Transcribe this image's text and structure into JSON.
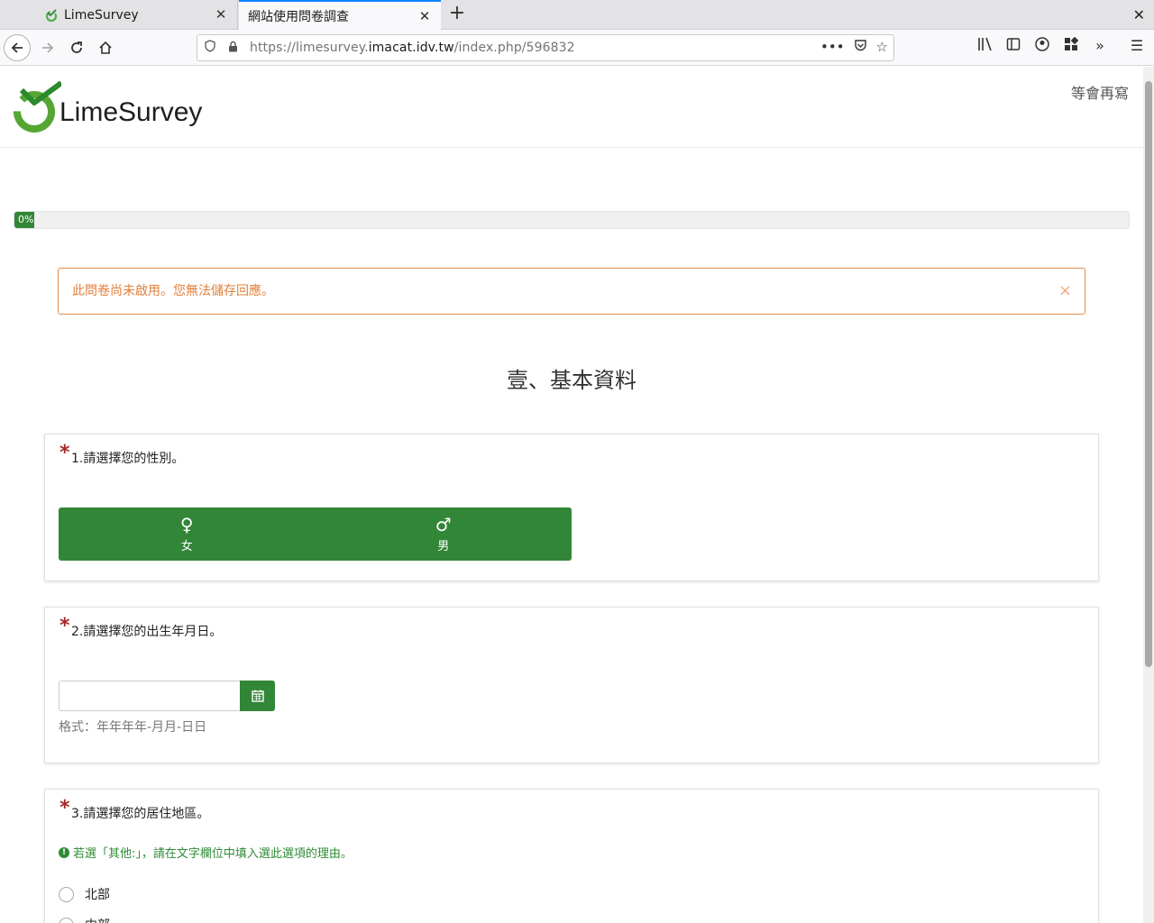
{
  "browser": {
    "tabs": [
      {
        "title": "LimeSurvey"
      },
      {
        "title": "網站使用問卷調查"
      }
    ],
    "url_prefix": "https://limesurvey.",
    "url_host": "imacat.idv.tw",
    "url_path": "/index.php/596832"
  },
  "header": {
    "logo_text": "LimeSurvey",
    "save_later": "等會再寫"
  },
  "progress": {
    "label": "0%",
    "value": 0
  },
  "alert": {
    "text": "此問卷尚未啟用。您無法儲存回應。",
    "close": "×"
  },
  "group": {
    "title": "壹、基本資料"
  },
  "questions": [
    {
      "required_mark": "*",
      "text": "1.請選擇您的性別。",
      "options": [
        {
          "symbol": "♀",
          "label": "女"
        },
        {
          "symbol": "♂",
          "label": "男"
        }
      ]
    },
    {
      "required_mark": "*",
      "text": "2.請選擇您的出生年月日。",
      "date_value": "",
      "help": "格式：年年年年-月月-日日"
    },
    {
      "required_mark": "*",
      "text": "3.請選擇您的居住地區。",
      "tip": "若選「其他:」，請在文字欄位中填入選此選項的理由。",
      "options": [
        {
          "label": "北部"
        },
        {
          "label": "中部"
        }
      ]
    }
  ],
  "colors": {
    "brand_green": "#328637",
    "alert_orange": "#e17f3a",
    "required_red": "#a62a2a"
  }
}
